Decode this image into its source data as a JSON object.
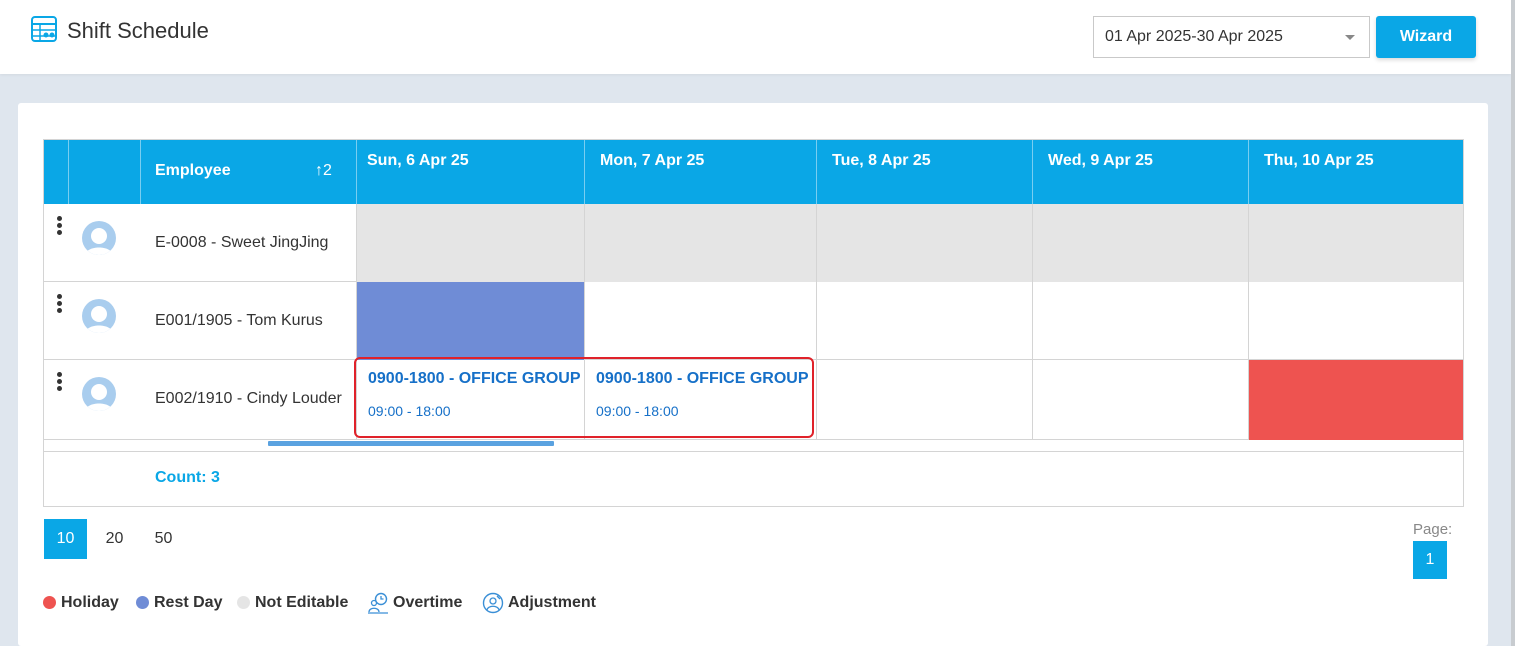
{
  "header": {
    "title": "Shift Schedule",
    "icon": "schedule-table-icon",
    "date_range": "01 Apr 2025-30 Apr 2025",
    "wizard_label": "Wizard"
  },
  "colors": {
    "accent": "#0aa7e6",
    "holiday": "#ee5350",
    "rest_day": "#6f8cd6",
    "not_editable": "#e5e5e5",
    "shift_text": "#1670c8",
    "highlight": "#e0222a"
  },
  "grid": {
    "columns": {
      "employee": "Employee",
      "sort_indicator": "↑2",
      "days": [
        "Sun, 6 Apr 25",
        "Mon, 7 Apr 25",
        "Tue, 8 Apr 25",
        "Wed, 9 Apr 25",
        "Thu, 10 Apr 25"
      ]
    },
    "rows": [
      {
        "employee": "E-0008 - Sweet JingJing",
        "cells": [
          "not_editable",
          "not_editable",
          "not_editable",
          "not_editable",
          "not_editable"
        ]
      },
      {
        "employee": "E001/1905 - Tom Kurus",
        "cells": [
          "rest_day",
          "empty",
          "empty",
          "empty",
          "empty"
        ]
      },
      {
        "employee": "E002/1910 - Cindy Louder",
        "cells": [
          "shift",
          "shift",
          "empty",
          "empty",
          "holiday"
        ],
        "shifts": [
          {
            "title": "0900-1800 - OFFICE GROUP",
            "time": "09:00 - 18:00"
          },
          {
            "title": "0900-1800 - OFFICE GROUP",
            "time": "09:00 - 18:00"
          }
        ]
      }
    ],
    "count": "Count: 3"
  },
  "pagination": {
    "sizes": [
      "10",
      "20",
      "50"
    ],
    "active_size": "10",
    "page_label": "Page:",
    "current_page": "1"
  },
  "legend": {
    "holiday": "Holiday",
    "rest_day": "Rest Day",
    "not_editable": "Not Editable",
    "overtime": "Overtime",
    "adjustment": "Adjustment"
  }
}
